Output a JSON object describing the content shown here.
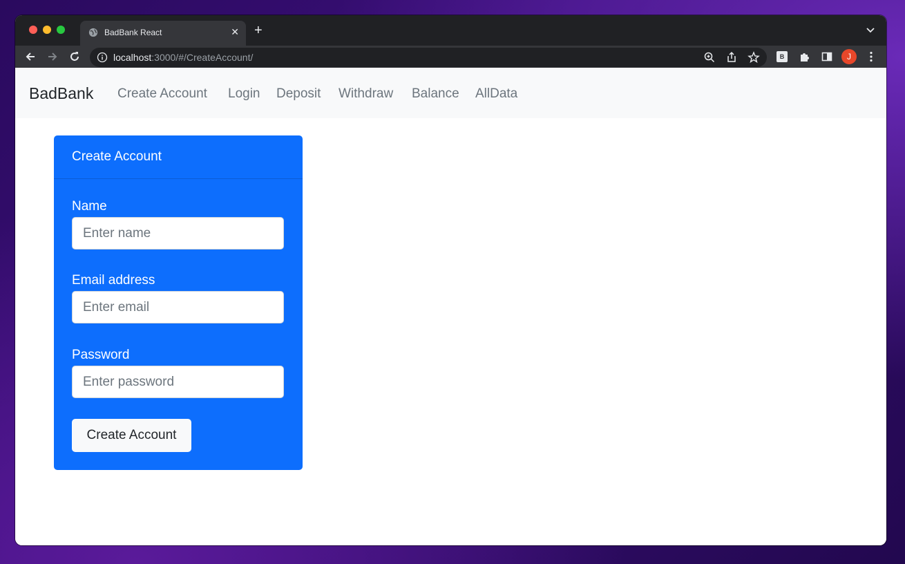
{
  "browser": {
    "tab_title": "BadBank React",
    "url_host": "localhost",
    "url_rest": ":3000/#/CreateAccount/",
    "avatar_initial": "J",
    "extension_letter": "B",
    "icons": [
      "back-icon",
      "forward-icon",
      "reload-icon",
      "info-icon",
      "zoom-icon",
      "share-icon",
      "star-icon",
      "extensions-icon",
      "sidepanel-icon",
      "menu-icon"
    ]
  },
  "navbar": {
    "brand": "BadBank",
    "links": [
      "Create Account",
      "Login",
      "Deposit",
      "Withdraw",
      "Balance",
      "AllData"
    ]
  },
  "card": {
    "header": "Create Account",
    "name_label": "Name",
    "name_placeholder": "Enter name",
    "email_label": "Email address",
    "email_placeholder": "Enter email",
    "password_label": "Password",
    "password_placeholder": "Enter password",
    "submit_label": "Create Account"
  },
  "colors": {
    "card_bg": "#0d6efd",
    "navbar_bg": "#f8f9fa",
    "avatar_bg": "#e8472a"
  }
}
